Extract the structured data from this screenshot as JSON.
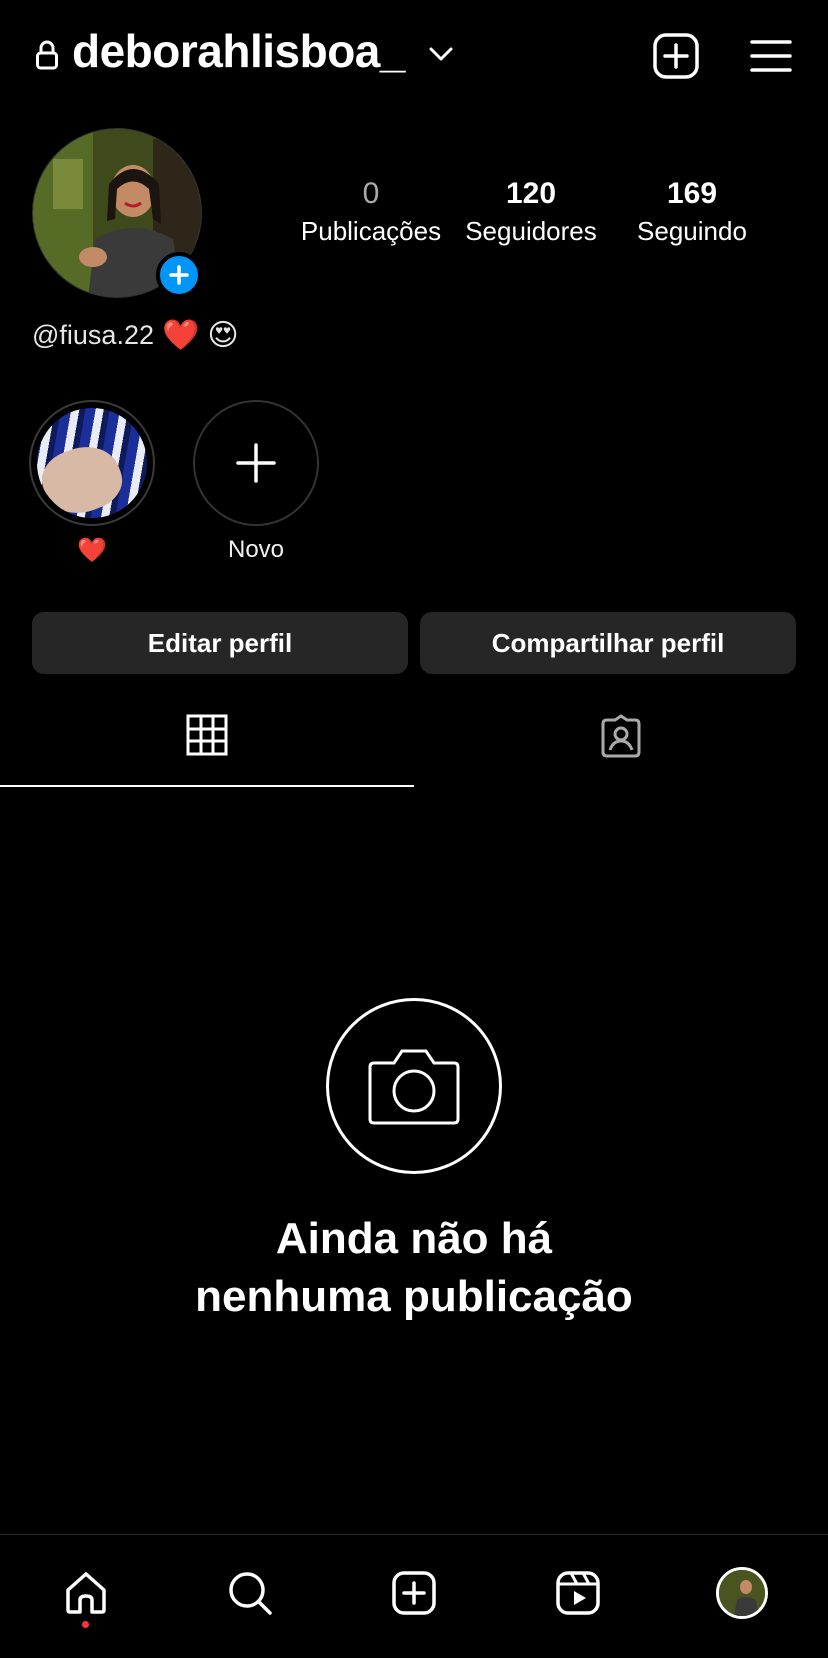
{
  "header": {
    "username": "deborahlisboa_",
    "accent_color": "#0095f6"
  },
  "stats": {
    "posts": {
      "value": "0",
      "label": "Publicações"
    },
    "followers": {
      "value": "120",
      "label": "Seguidores"
    },
    "following": {
      "value": "169",
      "label": "Seguindo"
    }
  },
  "bio": {
    "handle": "@fiusa.22",
    "emojis": [
      "❤️",
      "😍"
    ]
  },
  "highlights": [
    {
      "label": "❤️"
    },
    {
      "label": "Novo"
    }
  ],
  "actions": {
    "edit_label": "Editar perfil",
    "share_label": "Compartilhar perfil"
  },
  "tabs": [
    {
      "icon": "grid-icon",
      "active": true
    },
    {
      "icon": "tagged-icon",
      "active": false
    }
  ],
  "empty_state": {
    "icon": "camera-icon",
    "line1": "Ainda não há",
    "line2": "nenhuma publicação"
  },
  "bottom_nav": [
    {
      "icon": "home-icon",
      "active": true,
      "notification_dot_color": "#ff3040"
    },
    {
      "icon": "search-icon"
    },
    {
      "icon": "create-icon"
    },
    {
      "icon": "reels-icon"
    },
    {
      "icon": "profile-avatar"
    }
  ]
}
